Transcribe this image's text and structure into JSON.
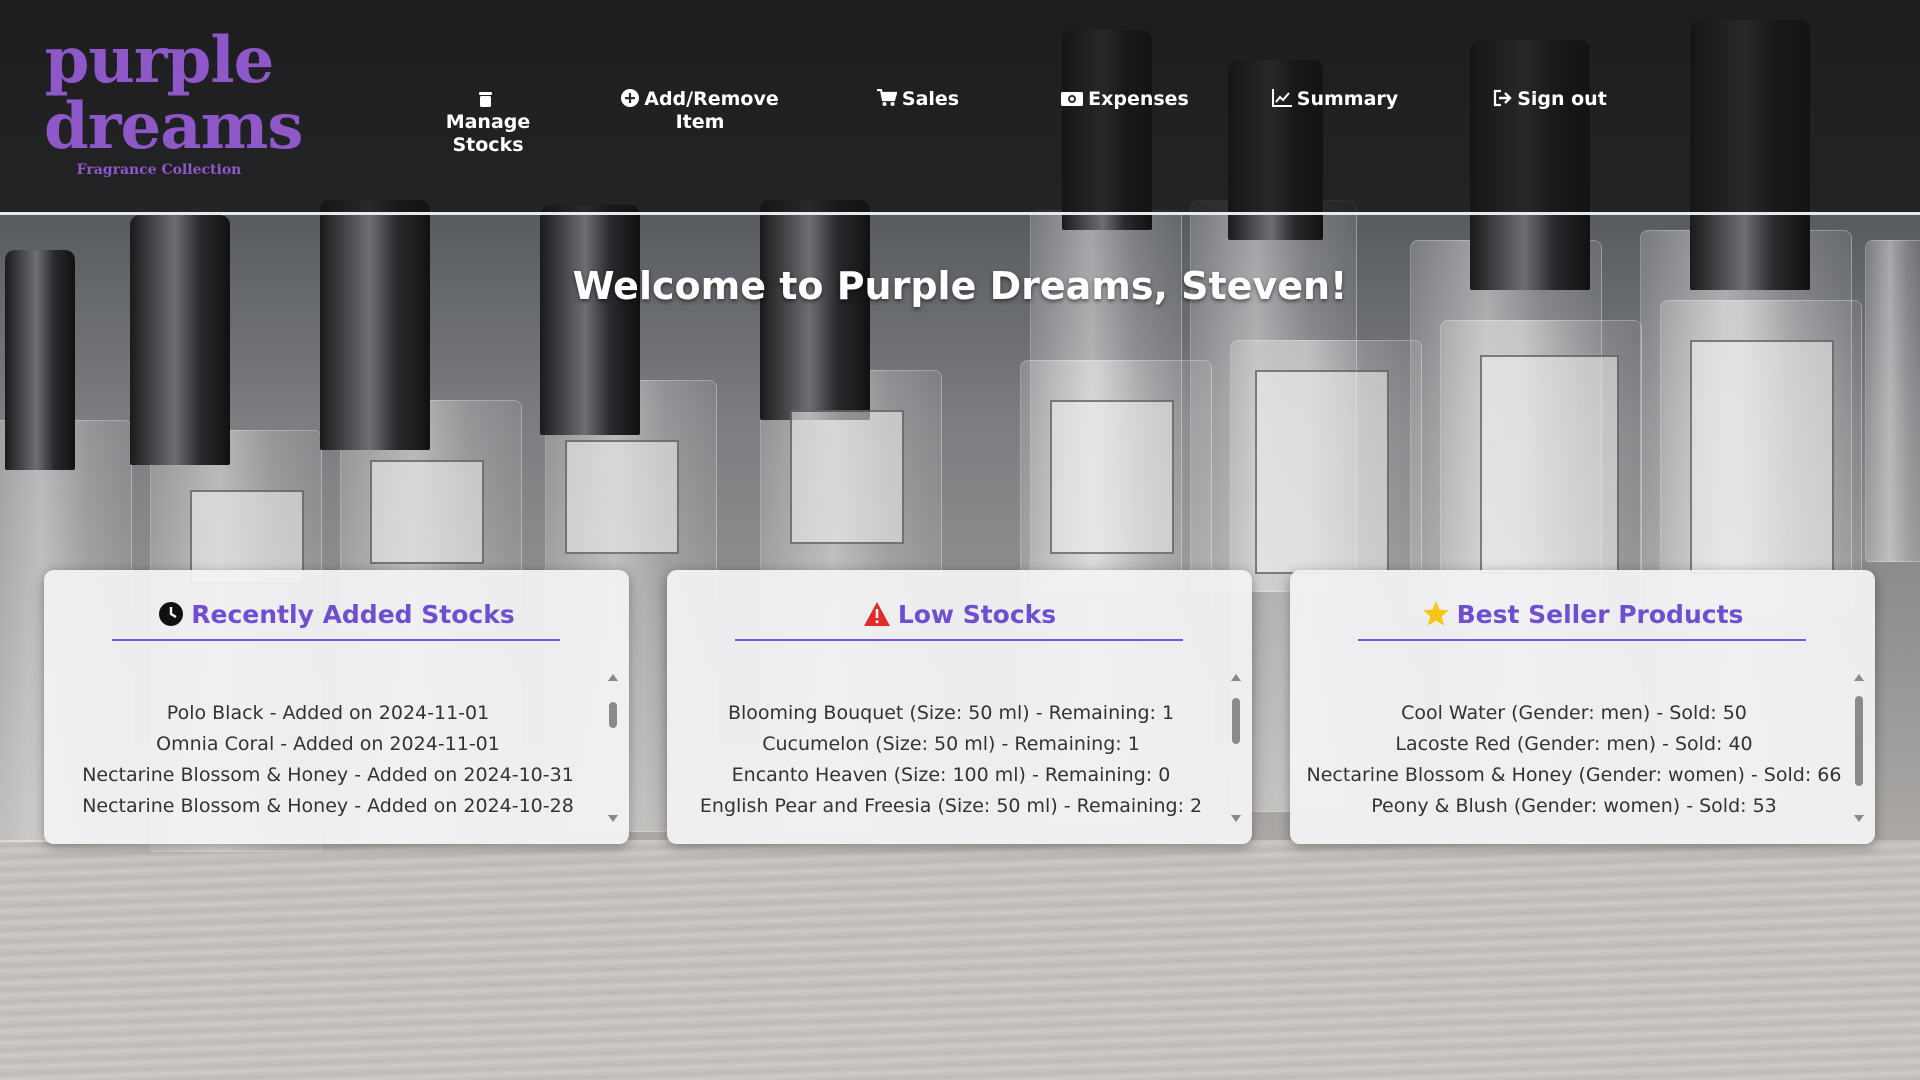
{
  "brand": {
    "line1": "purple",
    "line2": "dreams",
    "tagline": "Fragrance Collection"
  },
  "nav": [
    {
      "label": "Manage\nStocks",
      "icon": "trash-icon"
    },
    {
      "label": "Add/Remove\nItem",
      "icon": "plus-circle-icon"
    },
    {
      "label": "Sales",
      "icon": "cart-icon"
    },
    {
      "label": "Expenses",
      "icon": "money-icon"
    },
    {
      "label": "Summary",
      "icon": "line-chart-icon"
    },
    {
      "label": "Sign out",
      "icon": "sign-out-icon"
    }
  ],
  "welcome": "Welcome to Purple Dreams, Steven!",
  "cards": [
    {
      "title": "Recently Added Stocks",
      "icon": "clock-icon",
      "items": [
        "Polo Black - Added on 2024-11-01",
        "Omnia Coral - Added on 2024-11-01",
        "Nectarine Blossom & Honey - Added on 2024-10-31",
        "Nectarine Blossom & Honey - Added on 2024-10-28"
      ]
    },
    {
      "title": "Low Stocks",
      "icon": "warning-icon",
      "items": [
        "Blooming Bouquet (Size: 50 ml) - Remaining: 1",
        "Cucumelon (Size: 50 ml) - Remaining: 1",
        "Encanto Heaven (Size: 100 ml) - Remaining: 0",
        "English Pear and Freesia (Size: 50 ml) - Remaining: 2"
      ]
    },
    {
      "title": "Best Seller Products",
      "icon": "star-icon",
      "items": [
        "Cool Water (Gender: men) - Sold: 50",
        "Lacoste Red (Gender: men) - Sold: 40",
        "Nectarine Blossom & Honey (Gender: women) - Sold: 66",
        "Peony & Blush (Gender: women) - Sold: 53"
      ]
    }
  ],
  "colors": {
    "brand_purple": "#8e58c9",
    "accent_purple": "#6f4fd0",
    "warning_red": "#e02b2b",
    "star_gold": "#f5c518"
  }
}
